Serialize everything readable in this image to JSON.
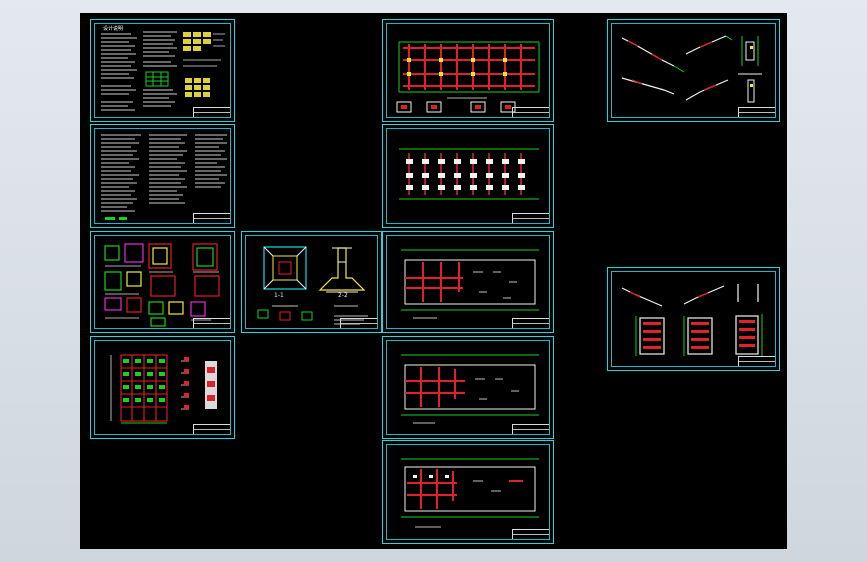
{
  "sheets": [
    {
      "id": "notes-1"
    },
    {
      "id": "notes-2"
    },
    {
      "id": "details-1"
    },
    {
      "id": "foundation-detail"
    },
    {
      "id": "elevation-1"
    },
    {
      "id": "plan-1"
    },
    {
      "id": "plan-2"
    },
    {
      "id": "plan-3"
    },
    {
      "id": "plan-4"
    },
    {
      "id": "plan-5"
    },
    {
      "id": "stair-1"
    },
    {
      "id": "stair-2"
    }
  ],
  "labels": {
    "notes_title": "设计说明",
    "section_1": "1-1",
    "section_2": "2-2",
    "plan_caption": "基础平面布置图"
  },
  "colors": {
    "canvas": "#000000",
    "frame": "#27d5e0",
    "wall": "#e0202a",
    "grid": "#19d01f",
    "text": "#f2f2f2",
    "yellow": "#f5e83c",
    "magenta": "#e32bd6"
  }
}
